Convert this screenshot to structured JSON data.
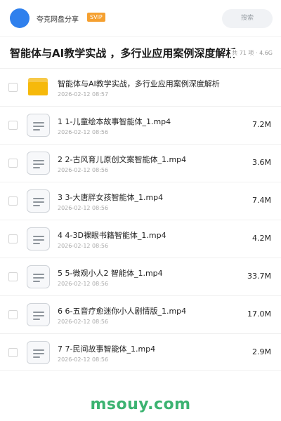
{
  "topbar": {
    "share_title": "夸克网盘分享",
    "badge": "SVIP",
    "search_placeholder": "搜索"
  },
  "header": {
    "title": "智能体与AI教学实战 ，多行业应用案例深度解析",
    "meta": "共 71 项 · 4.6G"
  },
  "files": [
    {
      "name": "智能体与AI教学实战，多行业应用案例深度解析",
      "date": "2026-02-12 08:57",
      "size": "",
      "icon": "folder-icon"
    },
    {
      "name": "1 1-儿童绘本故事智能体_1.mp4",
      "date": "2026-02-12 08:56",
      "size": "7.2M",
      "icon": "document-icon"
    },
    {
      "name": "2 2-古风育儿原创文案智能体_1.mp4",
      "date": "2026-02-12 08:56",
      "size": "3.6M",
      "icon": "document-icon"
    },
    {
      "name": "3 3-大唐胖女孩智能体_1.mp4",
      "date": "2026-02-12 08:56",
      "size": "7.4M",
      "icon": "document-icon"
    },
    {
      "name": "4 4-3D裸眼书籍智能体_1.mp4",
      "date": "2026-02-12 08:56",
      "size": "4.2M",
      "icon": "document-icon"
    },
    {
      "name": "5 5-微观小人2 智能体_1.mp4",
      "date": "2026-02-12 08:56",
      "size": "33.7M",
      "icon": "document-icon"
    },
    {
      "name": "6 6-五音疗愈迷你小人剧情版_1.mp4",
      "date": "2026-02-12 08:56",
      "size": "17.0M",
      "icon": "document-icon"
    },
    {
      "name": "7 7-民间故事智能体_1.mp4",
      "date": "2026-02-12 08:56",
      "size": "2.9M",
      "icon": "document-icon"
    }
  ],
  "footer": {
    "watermark": "msouy.com"
  },
  "colors": {
    "avatar": "#2f80ed",
    "badge": "#f5a030",
    "folder": "#f6b90b",
    "watermark": "#3cb371"
  }
}
